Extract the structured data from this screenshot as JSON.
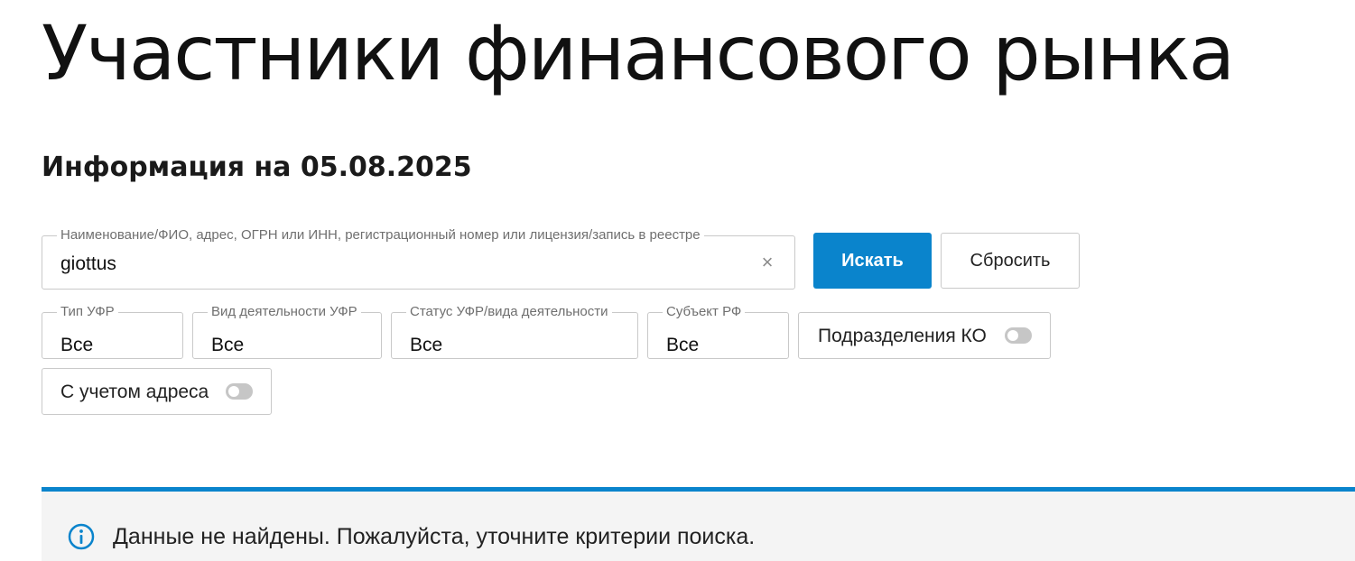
{
  "header": {
    "title": "Участники финансового рынка",
    "info_date": "Информация на 05.08.2025"
  },
  "search": {
    "label": "Наименование/ФИО, адрес, ОГРН или ИНН, регистрационный номер или лицензия/запись в реестре",
    "value": "giottus",
    "clear_icon": "×",
    "search_button": "Искать",
    "reset_button": "Сбросить"
  },
  "filters": {
    "type": {
      "label": "Тип УФР",
      "value": "Все"
    },
    "activity": {
      "label": "Вид деятельности УФР",
      "value": "Все"
    },
    "status": {
      "label": "Статус УФР/вида деятельности",
      "value": "Все"
    },
    "region": {
      "label": "Субъект РФ",
      "value": "Все"
    },
    "branches_toggle": {
      "label": "Подразделения КО",
      "on": false
    },
    "address_toggle": {
      "label": "С учетом адреса",
      "on": false
    }
  },
  "notice": {
    "icon": "info-icon",
    "text": "Данные не найдены. Пожалуйста, уточните критерии поиска."
  },
  "colors": {
    "accent": "#0a84cc",
    "notice_bg": "#f4f4f4",
    "border": "#c9c9c9"
  }
}
